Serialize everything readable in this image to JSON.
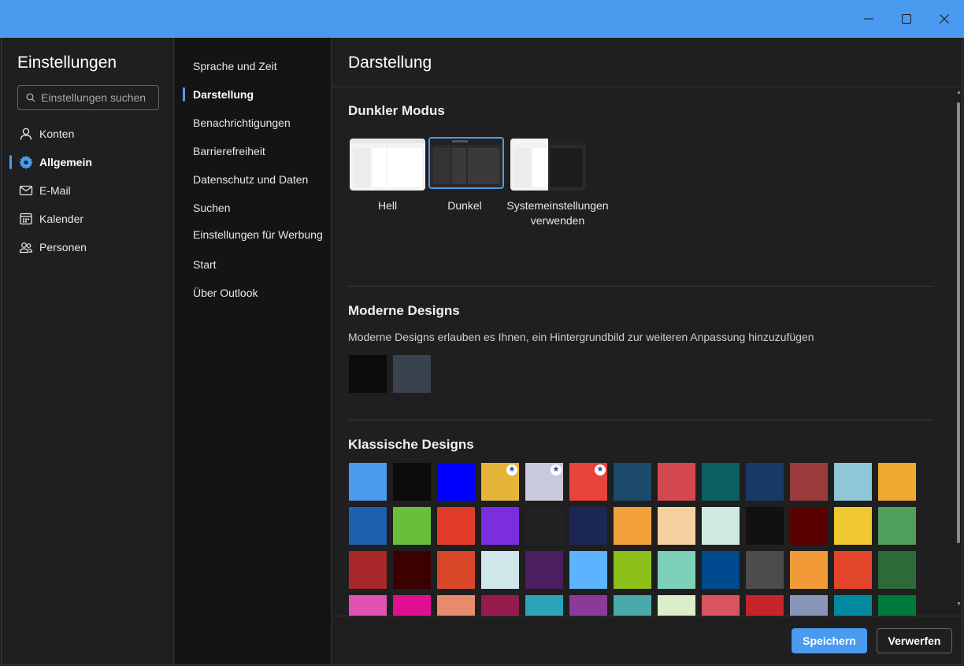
{
  "window": {
    "accent_color": "#4a9bf0",
    "controls": {
      "minimize": "minimize-icon",
      "maximize": "maximize-icon",
      "close": "close-icon"
    }
  },
  "sidebar": {
    "title": "Einstellungen",
    "search": {
      "placeholder": "Einstellungen suchen",
      "icon": "search-icon"
    },
    "items": [
      {
        "label": "Konten",
        "icon": "person-icon",
        "active": false
      },
      {
        "label": "Allgemein",
        "icon": "gear-icon",
        "active": true
      },
      {
        "label": "E-Mail",
        "icon": "mail-icon",
        "active": false
      },
      {
        "label": "Kalender",
        "icon": "calendar-icon",
        "active": false
      },
      {
        "label": "Personen",
        "icon": "people-icon",
        "active": false
      }
    ]
  },
  "subnav": {
    "items": [
      {
        "label": "Sprache und Zeit",
        "active": false
      },
      {
        "label": "Darstellung",
        "active": true
      },
      {
        "label": "Benachrichtigungen",
        "active": false
      },
      {
        "label": "Barrierefreiheit",
        "active": false
      },
      {
        "label": "Datenschutz und Daten",
        "active": false
      },
      {
        "label": "Suchen",
        "active": false
      },
      {
        "label": "Einstellungen für Werbung",
        "active": false
      },
      {
        "label": "Start",
        "active": false
      },
      {
        "label": "Über Outlook",
        "active": false
      }
    ]
  },
  "main": {
    "title": "Darstellung",
    "dark_mode": {
      "title": "Dunkler Modus",
      "options": [
        {
          "label": "Hell",
          "selected": false
        },
        {
          "label": "Dunkel",
          "selected": true
        },
        {
          "label": "Systemeinstellungen verwenden",
          "selected": false
        }
      ]
    },
    "modern": {
      "title": "Moderne Designs",
      "description": "Moderne Designs erlauben es Ihnen, ein Hintergrundbild zur weiteren Anpassung hinzuzufügen",
      "themes": [
        "#0b0b0b",
        "#3a4250"
      ]
    },
    "classic": {
      "title": "Klassische Designs",
      "themes": [
        "#4a9bf0",
        "#0b0b0b",
        "#0000ff",
        "#e6b43a",
        "#c9c9dd",
        "#e8443b",
        "#1b4a6b",
        "#d2484d",
        "#0b5f60",
        "#1a3a66",
        "#9b3a3a",
        "#8fc6d8",
        "#f0a930",
        "#1e5fb0",
        "#6abf3a",
        "#e23b2a",
        "#7a2ee0",
        "#222222",
        "#1c2655",
        "#f2a13a",
        "#f6d1a0",
        "#cfe9e2",
        "#111111",
        "#5a0000",
        "#f0c830",
        "#4ea05a",
        "#a8282a",
        "#3b0000",
        "#d9472b",
        "#cfe7ea",
        "#4a1e5f",
        "#5cb3ff",
        "#8cbf1a",
        "#7fd0b8",
        "#004a8f",
        "#4c4c4c",
        "#f29a38",
        "#e3452a",
        "#2d6a3a",
        "#e052b4",
        "#e00f90",
        "#e88a6c",
        "#951b4c",
        "#2ba3b8",
        "#8a3a9a",
        "#4aa9a9",
        "#d9eec9",
        "#d9545e",
        "#c8222a",
        "#8796b8",
        "#008a9e",
        "#007a3b",
        "#1a5a90",
        "#d0d8e0"
      ],
      "starred": [
        3,
        4,
        5
      ]
    }
  },
  "footer": {
    "save_label": "Speichern",
    "discard_label": "Verwerfen"
  }
}
